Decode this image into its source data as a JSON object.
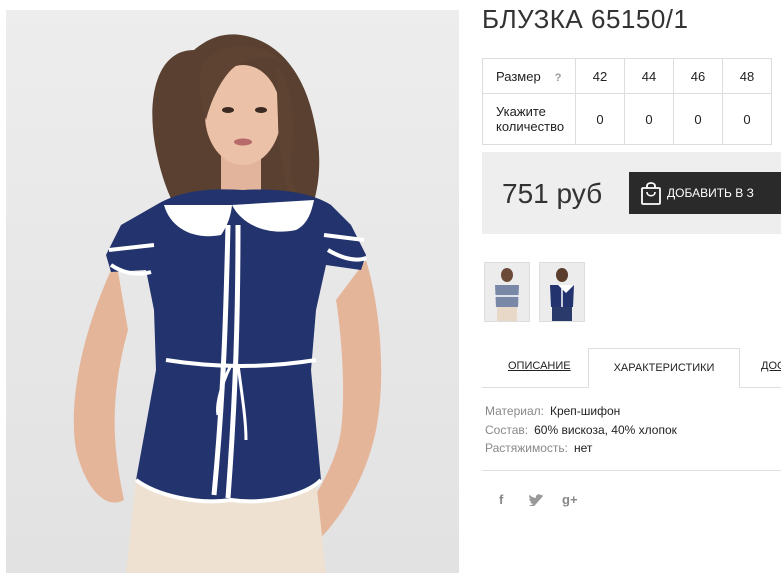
{
  "product": {
    "title": "БЛУЗКА 65150/1",
    "image_alt": "Model wearing navy blouse with white collar"
  },
  "sizes": {
    "size_label": "Размер",
    "help": "?",
    "values": [
      "42",
      "44",
      "46",
      "48"
    ],
    "qty_label": "Укажите количество",
    "quantities": [
      "0",
      "0",
      "0",
      "0"
    ]
  },
  "purchase": {
    "price": "751 руб",
    "cart_button": "ДОБАВИТЬ В З"
  },
  "tabs": {
    "description": "ОПИСАНИЕ",
    "characteristics": "ХАРАКТЕРИСТИКИ",
    "delivery": "ДОС"
  },
  "characteristics": [
    {
      "key": "Материал:",
      "value": "Креп-шифон"
    },
    {
      "key": "Состав:",
      "value": "60% вискоза, 40% хлопок"
    },
    {
      "key": "Растяжимость:",
      "value": "нет"
    }
  ],
  "social": {
    "facebook": "f",
    "twitter": "twitter-icon",
    "google": "g+"
  },
  "colors": {
    "navy": "#22336e",
    "button_bg": "#2a2a2a",
    "price_bg": "#eeeeee"
  }
}
